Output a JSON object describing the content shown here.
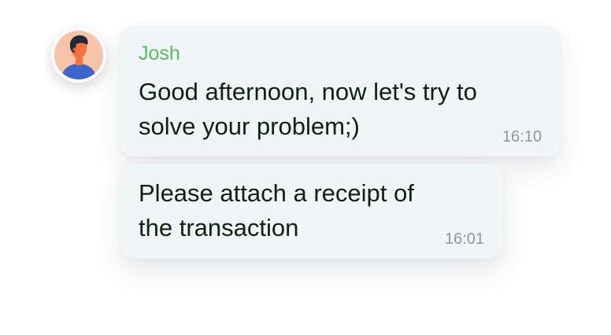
{
  "chat": {
    "avatar_icon": "person-avatar-icon",
    "messages": [
      {
        "sender": "Josh",
        "line1": "Good afternoon, now let's try to",
        "line2": "solve your problem;)",
        "time": "16:10"
      },
      {
        "line1": "Please attach a receipt of",
        "line2": "the transaction",
        "time": "16:01"
      }
    ]
  },
  "colors": {
    "sender_name": "#5cb85c",
    "bubble_bg": "#f0f5f8",
    "message_text": "#0f1f10",
    "timestamp": "#8d989f",
    "avatar_bg": "#f7c3a9",
    "avatar_hair": "#1e2a36",
    "avatar_skin": "#f2733d",
    "avatar_shirt": "#3c66cc"
  }
}
